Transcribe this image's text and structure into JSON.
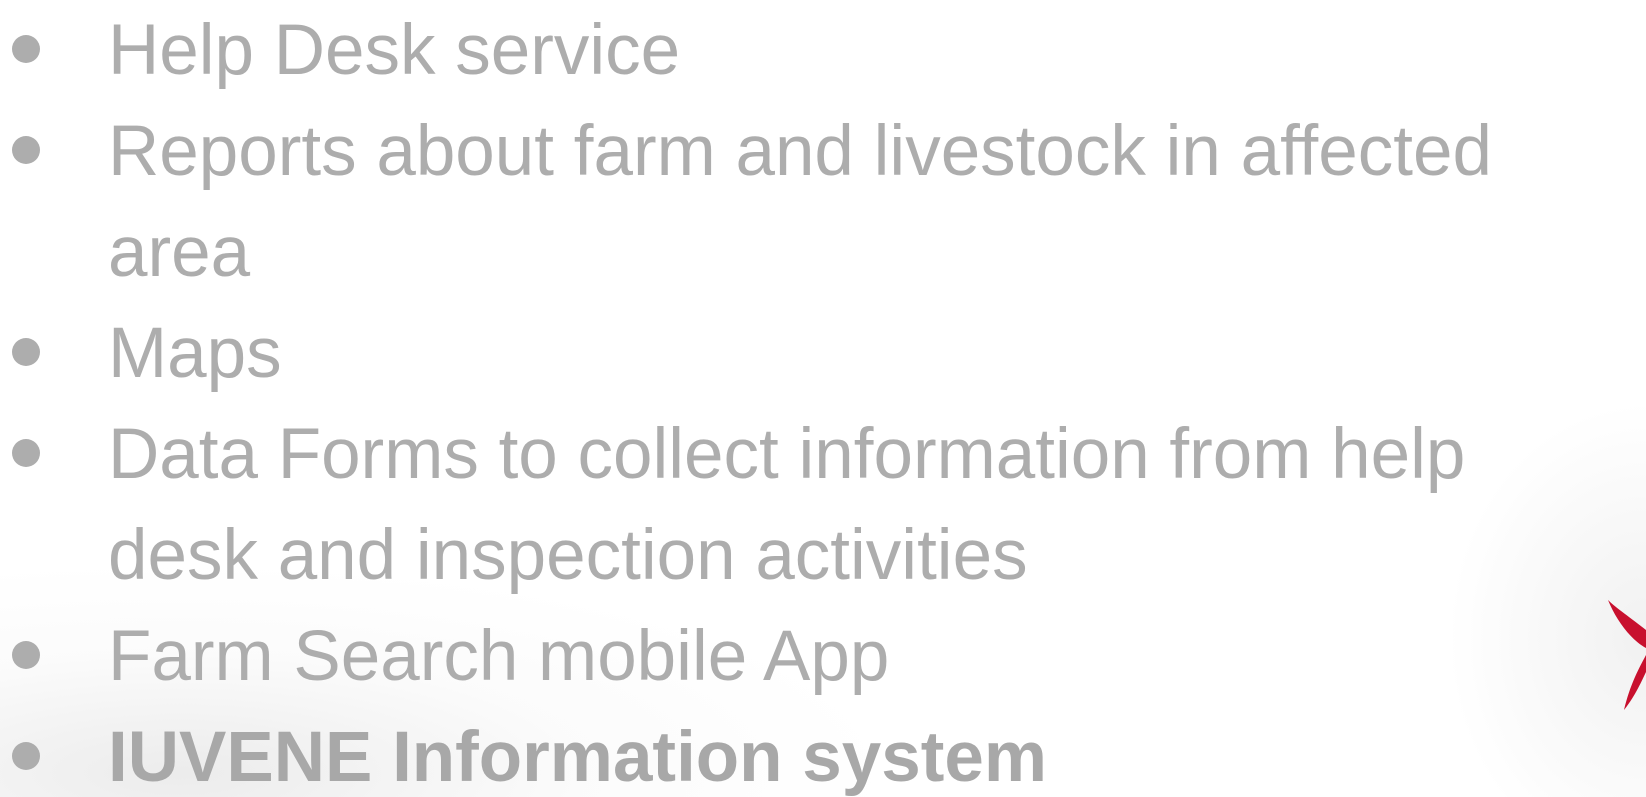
{
  "slide": {
    "bullets": [
      {
        "lines": [
          "Help Desk service"
        ],
        "bold": false
      },
      {
        "lines": [
          "Reports about farm and livestock in affected",
          "area"
        ],
        "bold": false
      },
      {
        "lines": [
          "Maps"
        ],
        "bold": false
      },
      {
        "lines": [
          "Data Forms to collect information from help",
          "desk and inspection activities"
        ],
        "bold": false
      },
      {
        "lines": [
          "Farm Search mobile App"
        ],
        "bold": false
      },
      {
        "lines": [
          "IUVENE Information system"
        ],
        "bold": true
      }
    ],
    "colors": {
      "text": "#adadad",
      "logo_red": "#c8102e"
    }
  }
}
